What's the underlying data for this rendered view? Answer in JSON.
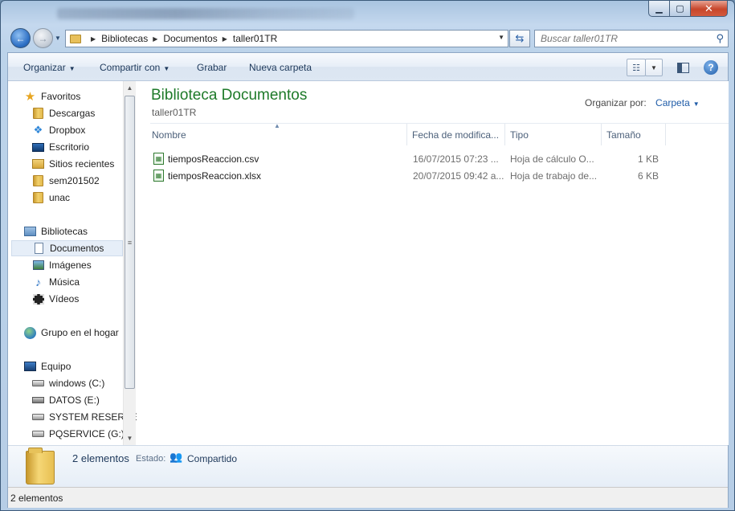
{
  "address": {
    "crumbs": [
      "Bibliotecas",
      "Documentos",
      "taller01TR"
    ],
    "search_placeholder": "Buscar taller01TR"
  },
  "toolbar": {
    "organize": "Organizar",
    "share_with": "Compartir con",
    "burn": "Grabar",
    "new_folder": "Nueva carpeta"
  },
  "nav": {
    "favorites": {
      "label": "Favoritos",
      "items": [
        "Descargas",
        "Dropbox",
        "Escritorio",
        "Sitios recientes",
        "sem201502",
        "unac"
      ]
    },
    "libraries": {
      "label": "Bibliotecas",
      "items": [
        "Documentos",
        "Imágenes",
        "Música",
        "Vídeos"
      ]
    },
    "homegroup": "Grupo en el hogar",
    "computer": {
      "label": "Equipo",
      "items": [
        "windows (C:)",
        "DATOS (E:)",
        "SYSTEM RESERVE",
        "PQSERVICE (G:)"
      ]
    }
  },
  "library": {
    "title": "Biblioteca Documentos",
    "subtitle": "taller01TR",
    "arrange_label": "Organizar por:",
    "arrange_value": "Carpeta"
  },
  "columns": {
    "name": "Nombre",
    "date": "Fecha de modifica...",
    "type": "Tipo",
    "size": "Tamaño"
  },
  "files": [
    {
      "name": "tiemposReaccion.csv",
      "date": "16/07/2015 07:23 ...",
      "type": "Hoja de cálculo O...",
      "size": "1 KB"
    },
    {
      "name": "tiemposReaccion.xlsx",
      "date": "20/07/2015 09:42 a...",
      "type": "Hoja de trabajo de...",
      "size": "6 KB"
    }
  ],
  "details": {
    "count": "2 elementos",
    "state_label": "Estado:",
    "state_value": "Compartido"
  },
  "status": {
    "text": "2 elementos"
  }
}
